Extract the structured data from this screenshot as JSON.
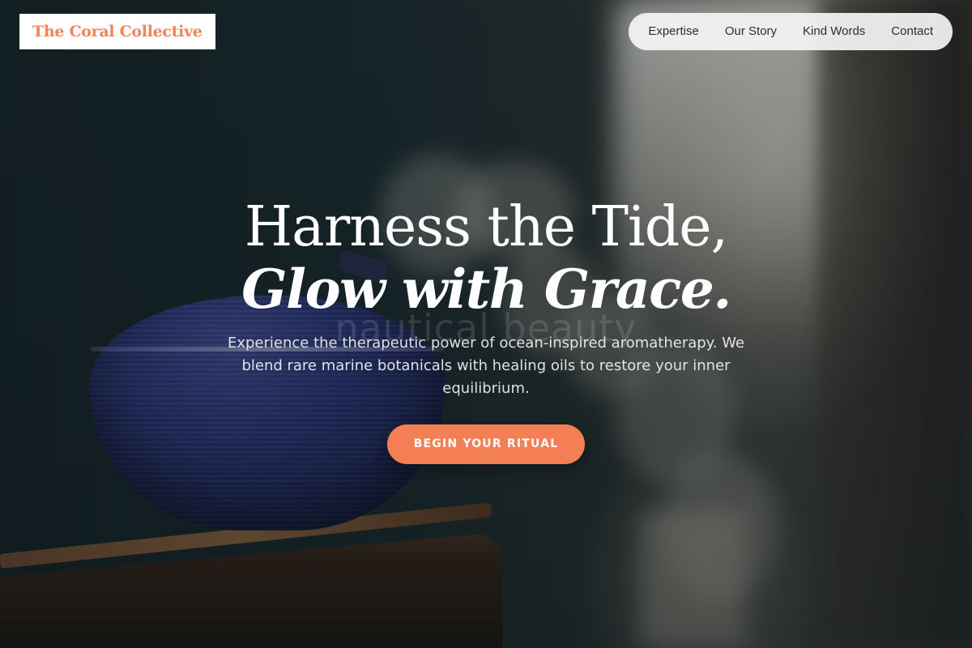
{
  "brand": {
    "name": "The Coral Collective",
    "accent_color": "#f57f55"
  },
  "nav": {
    "items": [
      {
        "label": "Expertise"
      },
      {
        "label": "Our Story"
      },
      {
        "label": "Kind Words"
      },
      {
        "label": "Contact"
      }
    ]
  },
  "hero": {
    "title_line1": "Harness the Tide,",
    "title_line2": "Glow with Grace.",
    "ghost_text": "nautical beauty",
    "subtitle": "Experience the therapeutic power of ocean-inspired aromatherapy. We blend rare marine botanicals with healing oils to restore your inner equilibrium.",
    "cta_label": "BEGIN YOUR RITUAL"
  }
}
